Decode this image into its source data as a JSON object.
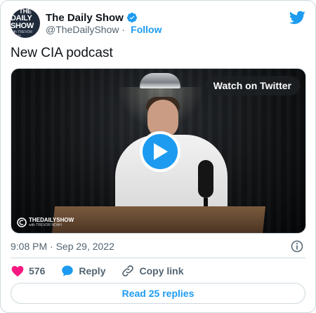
{
  "account": {
    "name": "The Daily Show",
    "handle": "@TheDailyShow",
    "separator": "·",
    "follow_label": "Follow",
    "avatar_text": {
      "line1": "THE",
      "line2": "DAILY SHOW",
      "line3": "with TREVOR NOAH"
    }
  },
  "tweet": {
    "text": "New CIA podcast",
    "timestamp": "9:08 PM · Sep 29, 2022"
  },
  "media": {
    "watch_label": "Watch on Twitter",
    "watermark": {
      "title": "THEDAILYSHOW",
      "subtitle": "with TREVOR NOAH"
    }
  },
  "actions": {
    "like_count": "576",
    "reply_label": "Reply",
    "copy_link_label": "Copy link"
  },
  "read_replies_label": "Read 25 replies",
  "icons": {
    "verified": "verified-badge-icon",
    "twitter": "twitter-bird-icon",
    "play": "play-icon",
    "info": "info-icon",
    "like": "heart-icon",
    "reply": "speech-bubble-icon",
    "copy_link": "link-icon"
  },
  "colors": {
    "accent": "#1d9bf0",
    "like": "#f91880",
    "text_primary": "#0f1419",
    "text_secondary": "#536471",
    "border": "#cfd9de"
  }
}
